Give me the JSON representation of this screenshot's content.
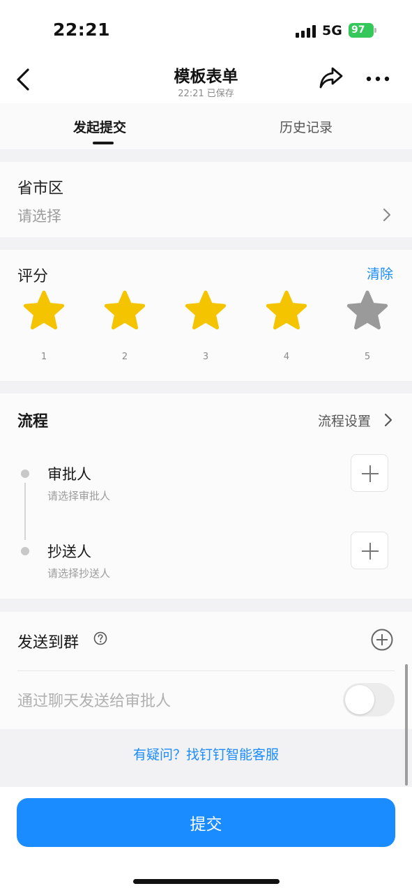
{
  "status_bar": {
    "time": "22:21",
    "network": "5G",
    "battery": "97"
  },
  "nav": {
    "title": "模板表单",
    "subtitle": "22:21 已保存"
  },
  "tabs": [
    {
      "label": "发起提交"
    },
    {
      "label": "历史记录"
    }
  ],
  "region_field": {
    "label": "省市区",
    "placeholder": "请选择"
  },
  "rating_field": {
    "label": "评分",
    "clear_label": "清除",
    "value": 4,
    "max": 5,
    "star_labels": [
      "1",
      "2",
      "3",
      "4",
      "5"
    ],
    "filled_color": "#f5c400",
    "empty_color": "#9a9a9a"
  },
  "flow": {
    "title": "流程",
    "settings_label": "流程设置",
    "steps": [
      {
        "name": "审批人",
        "hint": "请选择审批人"
      },
      {
        "name": "抄送人",
        "hint": "请选择抄送人"
      }
    ]
  },
  "send_group": {
    "label": "发送到群",
    "chat_label": "通过聊天发送给审批人",
    "chat_toggle_on": false
  },
  "help_link": "有疑问？找钉钉智能客服",
  "submit_label": "提交",
  "accent_color": "#1a8cff"
}
